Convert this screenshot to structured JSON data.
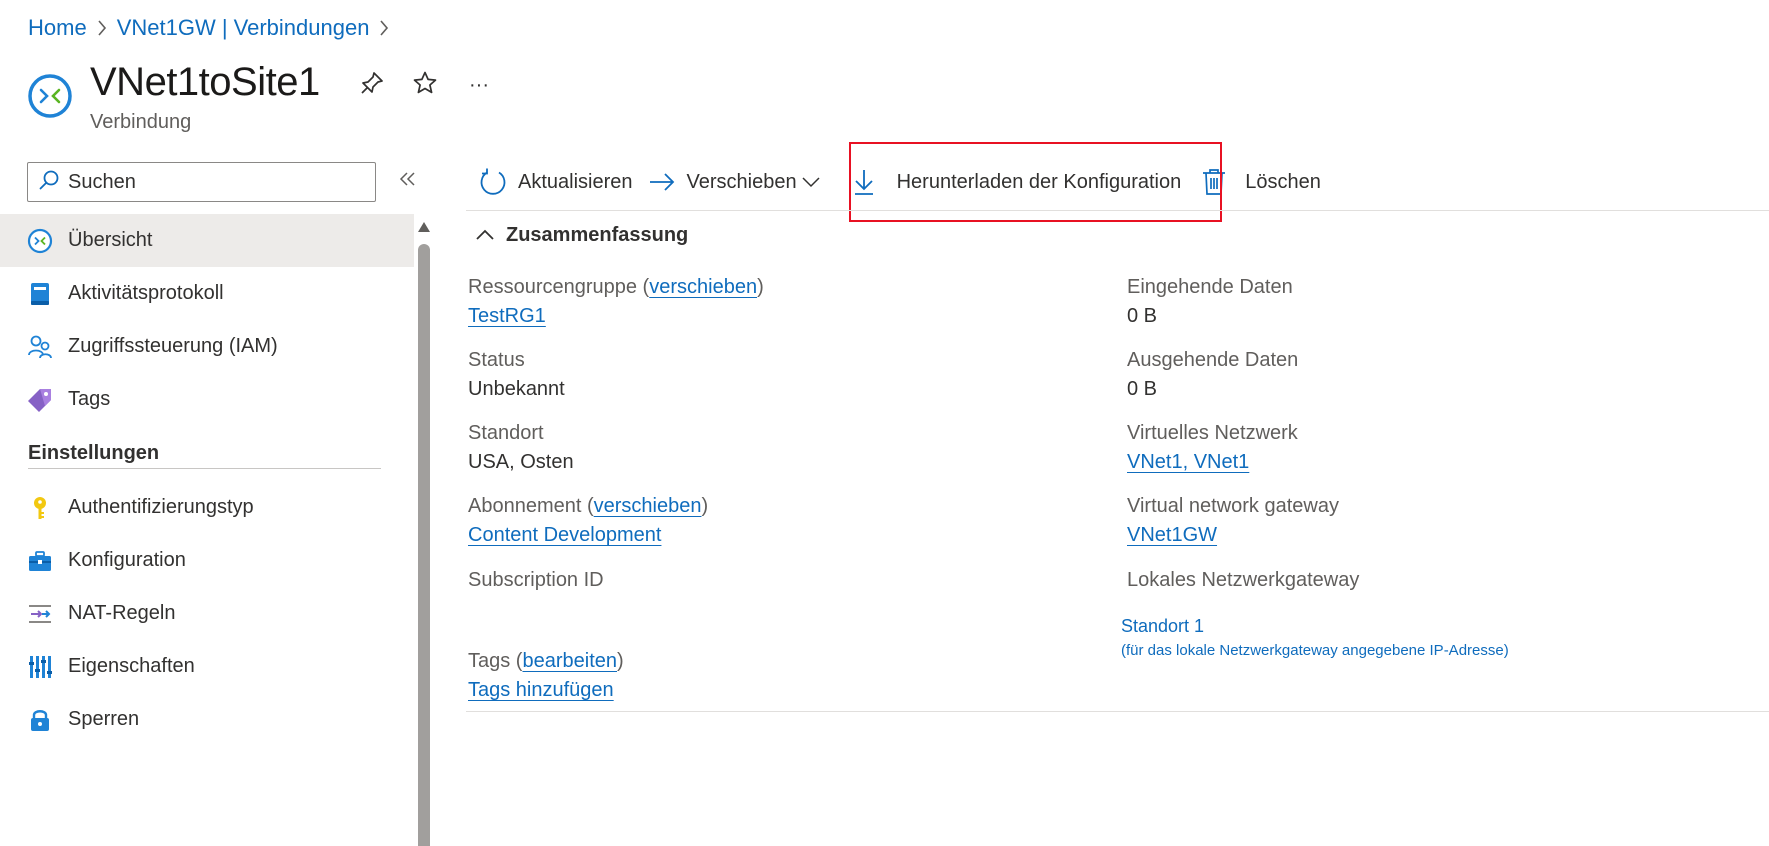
{
  "breadcrumb": {
    "items": [
      "Home",
      "VNet1GW | Verbindungen"
    ]
  },
  "header": {
    "title": "VNet1toSite1",
    "subtitle": "Verbindung",
    "more_label": "···"
  },
  "sidebar": {
    "search_placeholder": "Suchen",
    "items": [
      {
        "label": "Übersicht",
        "icon": "connection-icon",
        "selected": true
      },
      {
        "label": "Aktivitätsprotokoll",
        "icon": "activity-log-icon"
      },
      {
        "label": "Zugriffssteuerung (IAM)",
        "icon": "people-icon"
      },
      {
        "label": "Tags",
        "icon": "tag-icon"
      }
    ],
    "section_title": "Einstellungen",
    "settings_items": [
      {
        "label": "Authentifizierungstyp",
        "icon": "key-icon"
      },
      {
        "label": "Konfiguration",
        "icon": "toolbox-icon"
      },
      {
        "label": "NAT-Regeln",
        "icon": "nat-rules-icon"
      },
      {
        "label": "Eigenschaften",
        "icon": "properties-icon"
      },
      {
        "label": "Sperren",
        "icon": "lock-icon"
      }
    ]
  },
  "toolbar": {
    "refresh_label": "Aktualisieren",
    "move_label": "Verschieben",
    "download_label": "Herunterladen der Konfiguration",
    "delete_label": "Löschen"
  },
  "essentials": {
    "title": "Zusammenfassung",
    "left": {
      "resource_group_label": "Ressourcengruppe",
      "resource_group_move_link": "verschieben",
      "resource_group_value": "TestRG1",
      "status_label": "Status",
      "status_value": "Unbekannt",
      "location_label": "Standort",
      "location_value": "USA, Osten",
      "subscription_label": "Abonnement",
      "subscription_move_link": "verschieben",
      "subscription_value": "Content Development",
      "subscription_id_label": "Subscription ID",
      "tags_label": "Tags",
      "tags_edit_link": "bearbeiten",
      "tags_add_link": "Tags hinzufügen"
    },
    "right": {
      "data_in_label": "Eingehende Daten",
      "data_in_value": "0 B",
      "data_out_label": "Ausgehende Daten",
      "data_out_value": "0 B",
      "vnet_label": "Virtuelles Netzwerk",
      "vnet_value": "VNet1, VNet1",
      "vng_label": "Virtual network gateway",
      "vng_value": "VNet1GW",
      "lng_label": "Lokales Netzwerkgateway",
      "lng_value": "Standort 1",
      "lng_note": "(für das lokale Netzwerkgateway angegebene IP-Adresse)"
    }
  },
  "colors": {
    "link": "#0f6cbd",
    "highlight": "#e81123",
    "selected_bg": "#edebe9"
  }
}
